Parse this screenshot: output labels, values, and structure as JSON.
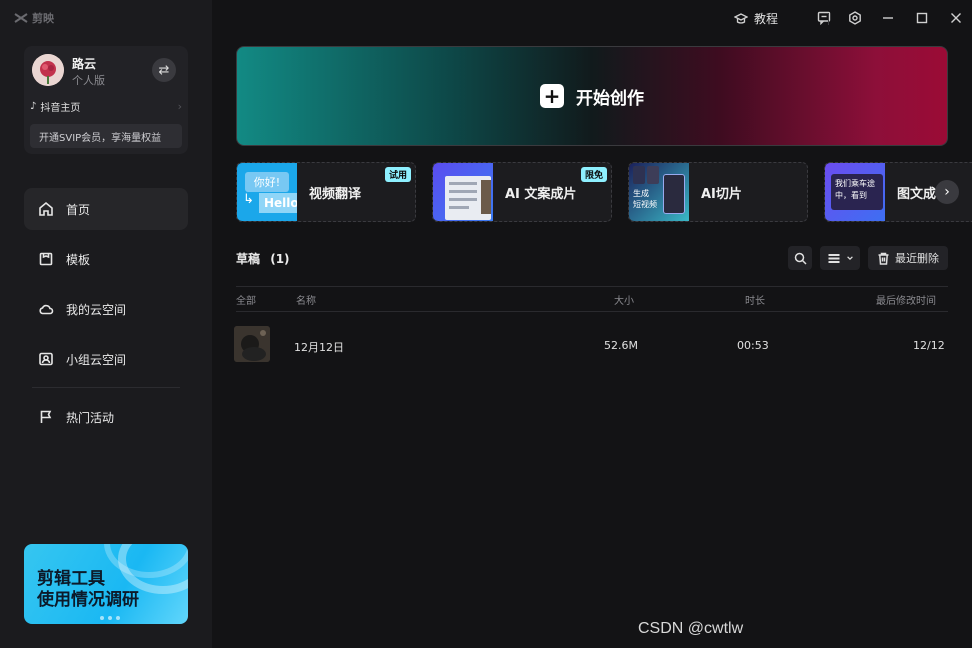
{
  "app": {
    "logo_text": "剪映"
  },
  "user": {
    "name": "路云",
    "plan": "个人版",
    "douyin_label": "抖音主页",
    "svip_text": "开通SVIP会员，享海量权益"
  },
  "nav": {
    "items": [
      {
        "label": "首页",
        "icon": "home-icon",
        "active": true
      },
      {
        "label": "模板",
        "icon": "template-icon"
      },
      {
        "label": "我的云空间",
        "icon": "cloud-icon"
      },
      {
        "label": "小组云空间",
        "icon": "group-cloud-icon"
      },
      {
        "label": "热门活动",
        "icon": "flag-icon"
      }
    ]
  },
  "promo": {
    "line1": "剪辑工具",
    "line2": "使用情况调研"
  },
  "titlebar": {
    "tutorial_label": "教程"
  },
  "start": {
    "label": "开始创作"
  },
  "features": [
    {
      "label": "视频翻译",
      "tag": "试用",
      "thumb_text_1": "你好!",
      "thumb_text_2": "Hello"
    },
    {
      "label": "AI 文案成片",
      "tag": "限免"
    },
    {
      "label": "AI切片",
      "thumb_text_1": "生成",
      "thumb_text_2": "短视频"
    },
    {
      "label": "图文成",
      "thumb_text_1": "我们乘车途",
      "thumb_text_2": "中，看到"
    }
  ],
  "drafts": {
    "title": "草稿",
    "count": "(1)",
    "recent_delete_label": "最近删除",
    "columns": {
      "all": "全部",
      "name": "名称",
      "size": "大小",
      "duration": "时长",
      "modified": "最后修改时间"
    },
    "rows": [
      {
        "name": "12月12日",
        "size": "52.6M",
        "duration": "00:53",
        "modified": "12/12"
      }
    ]
  },
  "watermark": "CSDN @cwtlw",
  "colors": {
    "accent_teal": "#128a84",
    "accent_magenta": "#9b0b36",
    "promo_blue": "#1ab8f3",
    "tag_cyan": "#8ef0ff"
  }
}
